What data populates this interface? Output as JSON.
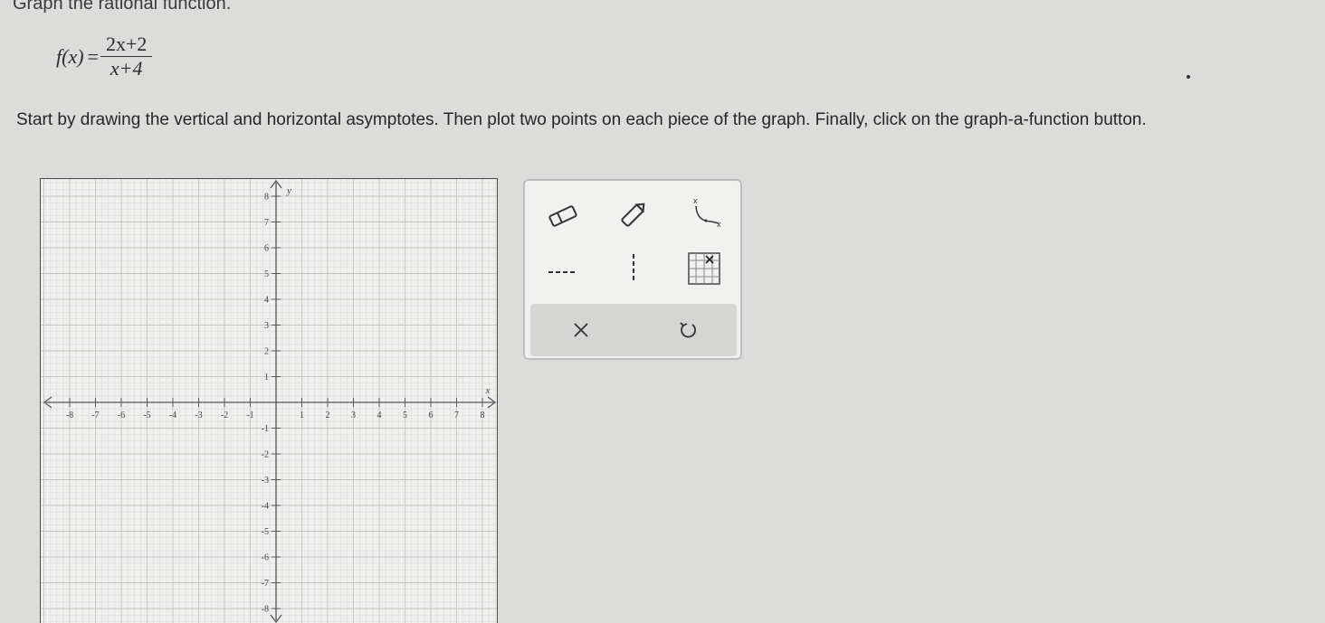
{
  "header": {
    "title": "Graph the rational function."
  },
  "function": {
    "lhs": "f(x)",
    "equals": "=",
    "numerator": "2x+2",
    "denominator": "x+4"
  },
  "instructions": "Start by drawing the vertical and horizontal asymptotes. Then plot two points on each piece of the graph. Finally, click on the graph-a-function button.",
  "graph": {
    "x_axis_label": "x",
    "y_axis_label": "y",
    "x_ticks_neg": [
      "-8",
      "-7",
      "-6",
      "-5",
      "-4",
      "-3",
      "-2",
      "-1"
    ],
    "x_ticks_pos": [
      "1",
      "2",
      "3",
      "4",
      "5",
      "6",
      "7",
      "8"
    ],
    "y_ticks_pos": [
      "1",
      "2",
      "3",
      "4",
      "5",
      "6",
      "7",
      "8"
    ],
    "y_ticks_neg": [
      "-1",
      "-2",
      "-3",
      "-4",
      "-5",
      "-6",
      "-7",
      "-8"
    ]
  },
  "toolbar": {
    "tools": [
      "eraser-icon",
      "pencil-icon",
      "graph-function-icon",
      "horizontal-asymptote-icon",
      "vertical-asymptote-icon",
      "point-grid-icon"
    ],
    "bottom_actions": [
      "clear-icon",
      "undo-icon"
    ]
  }
}
